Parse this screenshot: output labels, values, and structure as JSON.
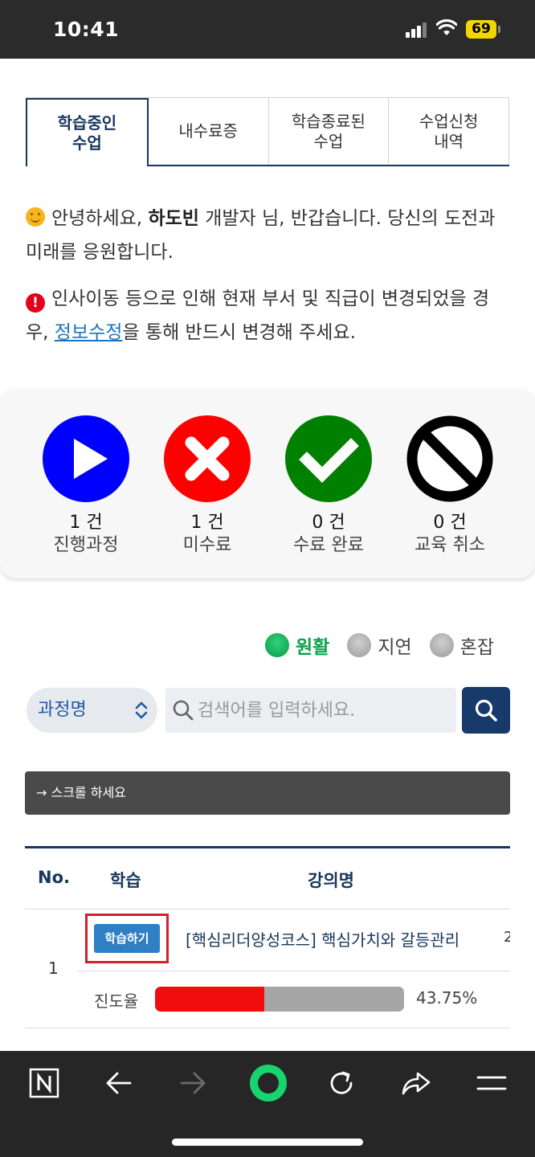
{
  "status_bar": {
    "time": "10:41",
    "battery": "69"
  },
  "tabs": [
    {
      "label": "학습중인\n수업",
      "active": true
    },
    {
      "label": "내수료증",
      "active": false
    },
    {
      "label": "학습종료된\n수업",
      "active": false
    },
    {
      "label": "수업신청\n내역",
      "active": false
    }
  ],
  "notice": {
    "greeting_pre": "안녕하세요, ",
    "user_name": "하도빈",
    "greeting_post": " 개발자 님, 반갑습니다. 당신의 도전과 미래를 응원합니다.",
    "alert_pre": "인사이동 등으로 인해 현재 부서 및 직급이 변경되었을 경우, ",
    "alert_link": "정보수정",
    "alert_post": "을 통해 반드시 변경해 주세요."
  },
  "stats": [
    {
      "count": "1 건",
      "label": "진행과정",
      "color": "#0000ff",
      "icon": "play-icon"
    },
    {
      "count": "1 건",
      "label": "미수료",
      "color": "#ff0000",
      "icon": "x-icon"
    },
    {
      "count": "0 건",
      "label": "수료 완료",
      "color": "#008000",
      "icon": "check-icon"
    },
    {
      "count": "0 건",
      "label": "교육 취소",
      "color": "#000000",
      "icon": "prohibited-icon"
    }
  ],
  "legend": {
    "smooth": "원활",
    "delay": "지연",
    "busy": "혼잡"
  },
  "search": {
    "select_value": "과정명",
    "placeholder": "검색어를 입력하세요."
  },
  "scroll_hint": "→ 스크롤 하세요",
  "table": {
    "headers": {
      "no": "No.",
      "study": "학습",
      "title": "강의명"
    },
    "rows": [
      {
        "no": "1",
        "study_button": "학습하기",
        "title": "[핵심리더양성코스] 핵심가치와 갈등관리",
        "extra": "2",
        "progress_label": "진도율",
        "progress_value": "43.75%",
        "progress_percent": 43.75
      }
    ]
  },
  "colors": {
    "navy": "#17365d",
    "progress_fill": "#f20d0d",
    "accent_green": "#0aa24b"
  }
}
